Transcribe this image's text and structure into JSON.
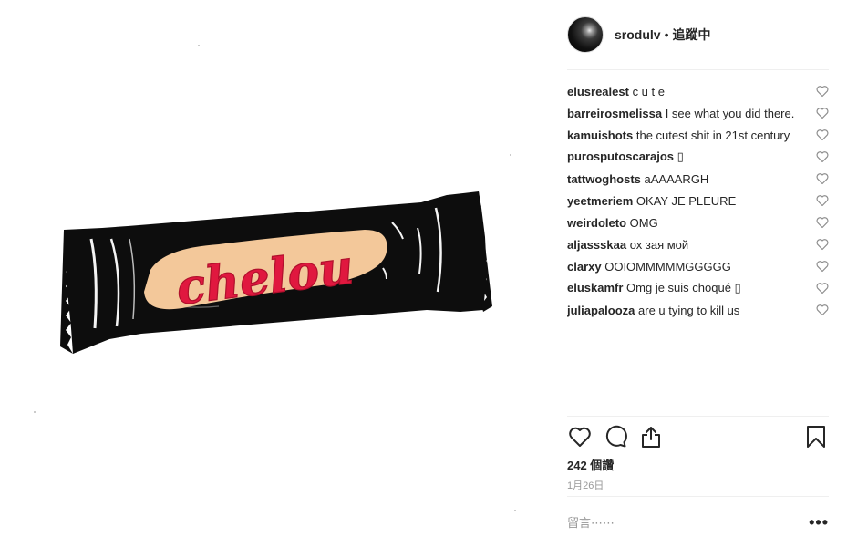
{
  "post": {
    "image_text": "chelou"
  },
  "header": {
    "username": "srodulv",
    "separator": "•",
    "follow_status": "追蹤中"
  },
  "comments": [
    {
      "user": "elusrealest",
      "text": "c u t e"
    },
    {
      "user": "barreirosmelissa",
      "text": "I see what you did there."
    },
    {
      "user": "kamuishots",
      "text": "the cutest shit in 21st century"
    },
    {
      "user": "purosputoscarajos",
      "text": "▯"
    },
    {
      "user": "tattwoghosts",
      "text": "aAAAARGH"
    },
    {
      "user": "yeetmeriem",
      "text": "OKAY JE PLEURE"
    },
    {
      "user": "weirdoleto",
      "text": "OMG"
    },
    {
      "user": "aljassskaa",
      "text": "ох зая мой"
    },
    {
      "user": "clarxy",
      "text": "OOIOMMMMMGGGGG"
    },
    {
      "user": "eluskamfr",
      "text": "Omg je suis choqué ▯"
    },
    {
      "user": "juliapalooza",
      "text": "are u tying to kill us"
    }
  ],
  "actions": {
    "like_icon": "heart-icon",
    "comment_icon": "comment-icon",
    "share_icon": "share-icon",
    "save_icon": "bookmark-icon"
  },
  "likes_text": "242 個讚",
  "date_text": "1月26日",
  "comment_input": {
    "placeholder": "留言⋯⋯"
  },
  "more_label": "•••"
}
